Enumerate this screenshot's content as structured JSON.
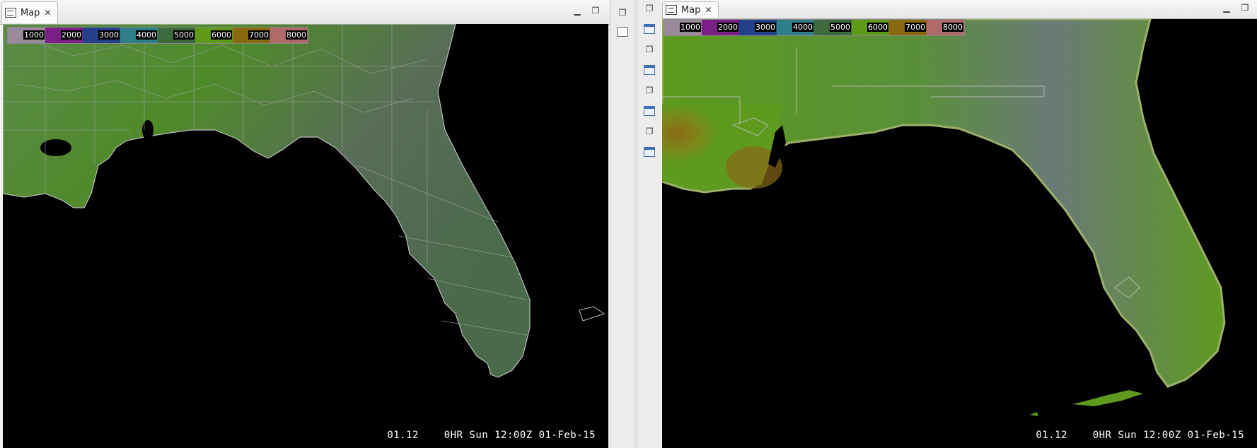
{
  "left_panel": {
    "tab_label": "Map",
    "tab_icon": "map-editor-icon",
    "minimize_icon": "minimize-icon",
    "restore_icon": "restore-icon",
    "colorbar_labels": [
      "1000",
      "2000",
      "3000",
      "4000",
      "5000",
      "6000",
      "7000",
      "8000"
    ],
    "footer_value": "01.12",
    "footer_time": "0HR Sun 12:00Z 01-Feb-15"
  },
  "right_panel": {
    "tab_label": "Map",
    "tab_icon": "map-editor-icon",
    "minimize_icon": "minimize-icon",
    "restore_icon": "restore-icon",
    "colorbar_labels": [
      "1000",
      "2000",
      "3000",
      "4000",
      "5000",
      "6000",
      "7000",
      "8000"
    ],
    "footer_value": "01.12",
    "footer_time": "0HR Sun 12:00Z 01-Feb-15"
  },
  "colorbar_colors": [
    "#9a8a9a",
    "#7a1f86",
    "#24408a",
    "#2f7f88",
    "#3d6b3d",
    "#5f9a18",
    "#8a6a10",
    "#b06a6a"
  ],
  "land_color": "#4b8a2a",
  "land_color_right": "#5d9a1e",
  "boundary_color": "#c8c8c8"
}
